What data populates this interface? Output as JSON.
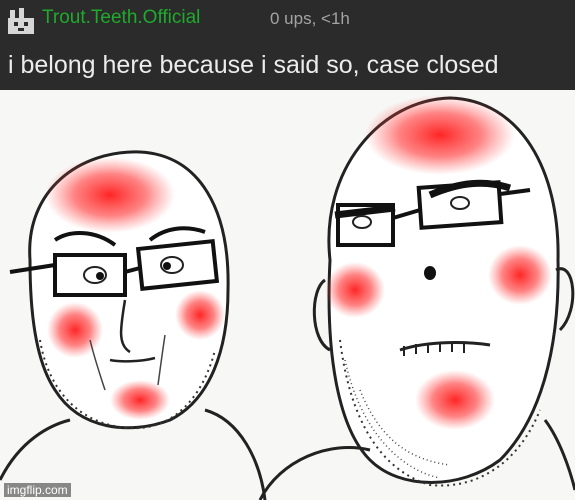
{
  "comment": {
    "username": "Trout.Teeth.Official",
    "meta": "0 ups, <1h",
    "text": "i belong here because i said so, case closed"
  },
  "meme": {
    "watermark": "imgflip.com"
  },
  "colors": {
    "bar_background": "#2b2b2b",
    "username": "#1faa2c",
    "meta": "#a3a3a3",
    "comment_text": "#ececec",
    "blush": "#ff2020"
  }
}
